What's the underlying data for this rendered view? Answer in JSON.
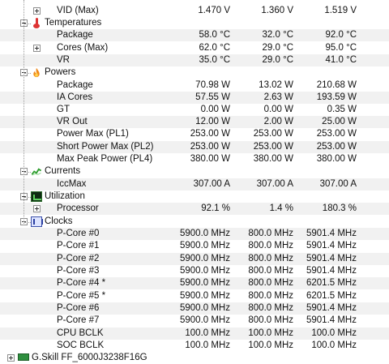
{
  "top_partial": {
    "label": "",
    "v1": "",
    "v2": "",
    "v3": ""
  },
  "vid": {
    "label": "VID (Max)",
    "v1": "1.470 V",
    "v2": "1.360 V",
    "v3": "1.519 V"
  },
  "temperatures": {
    "title": "Temperatures",
    "icon": "thermometer-icon",
    "rows": [
      {
        "label": "Package",
        "v1": "58.0 °C",
        "v2": "32.0 °C",
        "v3": "92.0 °C"
      },
      {
        "label": "Cores (Max)",
        "v1": "62.0 °C",
        "v2": "29.0 °C",
        "v3": "95.0 °C"
      },
      {
        "label": "VR",
        "v1": "35.0 °C",
        "v2": "29.0 °C",
        "v3": "41.0 °C"
      }
    ]
  },
  "powers": {
    "title": "Powers",
    "icon": "flame-icon",
    "rows": [
      {
        "label": "Package",
        "v1": "70.98 W",
        "v2": "13.02 W",
        "v3": "210.68 W"
      },
      {
        "label": "IA Cores",
        "v1": "57.55 W",
        "v2": "2.63 W",
        "v3": "193.59 W"
      },
      {
        "label": "GT",
        "v1": "0.00 W",
        "v2": "0.00 W",
        "v3": "0.35 W"
      },
      {
        "label": "VR Out",
        "v1": "12.00 W",
        "v2": "2.00 W",
        "v3": "25.00 W"
      },
      {
        "label": "Power Max (PL1)",
        "v1": "253.00 W",
        "v2": "253.00 W",
        "v3": "253.00 W"
      },
      {
        "label": "Short Power Max (PL2)",
        "v1": "253.00 W",
        "v2": "253.00 W",
        "v3": "253.00 W"
      },
      {
        "label": "Max Peak Power (PL4)",
        "v1": "380.00 W",
        "v2": "380.00 W",
        "v3": "380.00 W"
      }
    ]
  },
  "currents": {
    "title": "Currents",
    "icon": "current-graph-icon",
    "rows": [
      {
        "label": "IccMax",
        "v1": "307.00 A",
        "v2": "307.00 A",
        "v3": "307.00 A"
      }
    ]
  },
  "utilization": {
    "title": "Utilization",
    "icon": "utilization-chip-icon",
    "rows": [
      {
        "label": "Processor",
        "v1": "92.1 %",
        "v2": "1.4 %",
        "v3": "180.3 %"
      }
    ]
  },
  "clocks": {
    "title": "Clocks",
    "icon": "clock-bars-icon",
    "rows": [
      {
        "label": "P-Core #0",
        "v1": "5900.0 MHz",
        "v2": "800.0 MHz",
        "v3": "5901.4 MHz"
      },
      {
        "label": "P-Core #1",
        "v1": "5900.0 MHz",
        "v2": "800.0 MHz",
        "v3": "5901.4 MHz"
      },
      {
        "label": "P-Core #2",
        "v1": "5900.0 MHz",
        "v2": "800.0 MHz",
        "v3": "5901.4 MHz"
      },
      {
        "label": "P-Core #3",
        "v1": "5900.0 MHz",
        "v2": "800.0 MHz",
        "v3": "5901.4 MHz"
      },
      {
        "label": "P-Core #4 *",
        "v1": "5900.0 MHz",
        "v2": "800.0 MHz",
        "v3": "6201.5 MHz"
      },
      {
        "label": "P-Core #5 *",
        "v1": "5900.0 MHz",
        "v2": "800.0 MHz",
        "v3": "6201.5 MHz"
      },
      {
        "label": "P-Core #6",
        "v1": "5900.0 MHz",
        "v2": "800.0 MHz",
        "v3": "5901.4 MHz"
      },
      {
        "label": "P-Core #7",
        "v1": "5900.0 MHz",
        "v2": "800.0 MHz",
        "v3": "5901.4 MHz"
      },
      {
        "label": "CPU BCLK",
        "v1": "100.0 MHz",
        "v2": "100.0 MHz",
        "v3": "100.0 MHz"
      },
      {
        "label": "SOC BCLK",
        "v1": "100.0 MHz",
        "v2": "100.0 MHz",
        "v3": "100.0 MHz"
      }
    ]
  },
  "next_device": {
    "label": "G.Skill FF_6000J3238F16G",
    "icon": "memory-module-icon"
  },
  "colors": {
    "alt_row": "#f1f1f1",
    "text": "#111111",
    "tree_line": "#9a9a9a"
  }
}
